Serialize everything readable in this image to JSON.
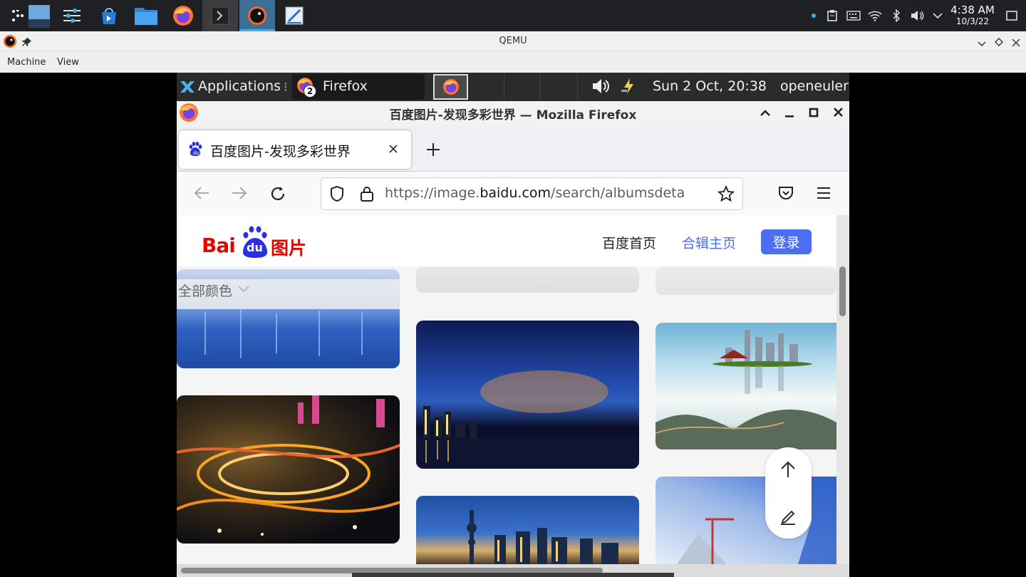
{
  "host": {
    "taskbar_apps": [
      "app-launcher-icon",
      "desktop-icon",
      "settings-icon",
      "discover-store-icon",
      "file-manager-icon",
      "firefox-icon",
      "terminal-icon",
      "qemu-icon",
      "screenshot-tool-icon"
    ],
    "clock": {
      "time": "4:38 AM",
      "date": "10/3/22"
    }
  },
  "qemu": {
    "title": "QEMU",
    "menu": [
      "Machine",
      "View"
    ]
  },
  "guest_panel": {
    "applications_label": "Applications",
    "task_label": "Firefox",
    "task_badge": "2",
    "datetime": "Sun  2 Oct, 20:38",
    "user": "openeuler"
  },
  "firefox": {
    "window_title": "百度图片-发现多彩世界 — Mozilla Firefox",
    "tab_title": "百度图片-发现多彩世界",
    "url_prefix": "https://image.",
    "url_domain": "baidu.com",
    "url_path": "/search/albumsdeta"
  },
  "page": {
    "logo_text": "Bai",
    "logo_du": "du",
    "logo_suffix": "图片",
    "nav": {
      "home": "百度首页",
      "albums": "合辑主页",
      "login": "登录"
    },
    "color_filter": "全部颜色",
    "colors": {
      "accent": "#4e6ef2",
      "logo_red": "#e10601",
      "logo_blue": "#2932e1"
    }
  }
}
